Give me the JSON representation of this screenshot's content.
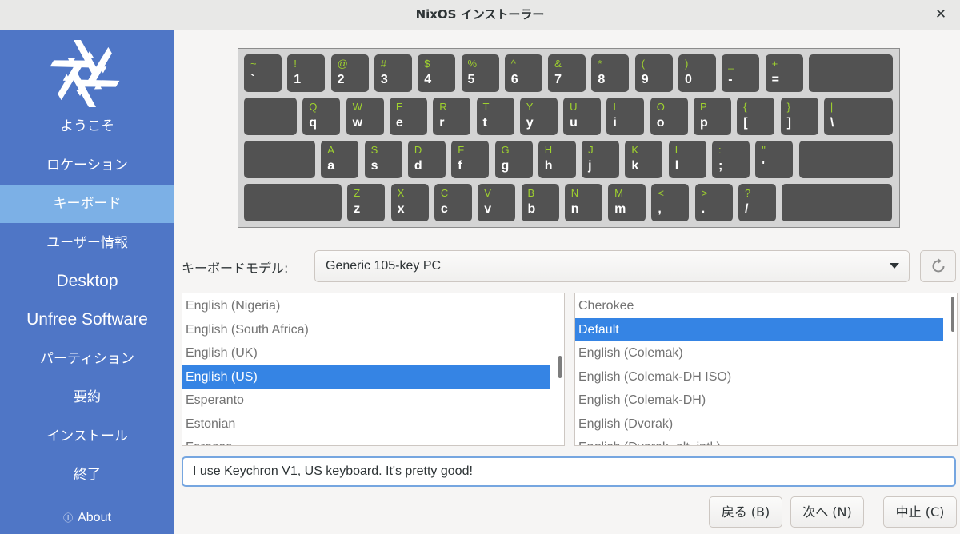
{
  "window": {
    "title": "NixOS インストーラー",
    "close_icon": "close-icon"
  },
  "sidebar": {
    "logo_icon": "nixos-snowflake-icon",
    "items": [
      {
        "label": "ようこそ"
      },
      {
        "label": "ロケーション"
      },
      {
        "label": "キーボード",
        "active": true
      },
      {
        "label": "ユーザー情報"
      },
      {
        "label": "Desktop"
      },
      {
        "label": "Unfree Software"
      },
      {
        "label": "パーティション"
      },
      {
        "label": "要約"
      },
      {
        "label": "インストール"
      },
      {
        "label": "終了"
      }
    ],
    "about_label": "About",
    "about_icon": "info-icon"
  },
  "keyboard_rows": [
    [
      {
        "u": "~",
        "l": "`"
      },
      {
        "u": "!",
        "l": "1"
      },
      {
        "u": "@",
        "l": "2"
      },
      {
        "u": "#",
        "l": "3"
      },
      {
        "u": "$",
        "l": "4"
      },
      {
        "u": "%",
        "l": "5"
      },
      {
        "u": "^",
        "l": "6"
      },
      {
        "u": "&",
        "l": "7"
      },
      {
        "u": "*",
        "l": "8"
      },
      {
        "u": "(",
        "l": "9"
      },
      {
        "u": ")",
        "l": "0"
      },
      {
        "u": "_",
        "l": "-"
      },
      {
        "u": "+",
        "l": "="
      },
      {
        "u": "",
        "l": ""
      }
    ],
    [
      {
        "u": "",
        "l": ""
      },
      {
        "u": "Q",
        "l": "q"
      },
      {
        "u": "W",
        "l": "w"
      },
      {
        "u": "E",
        "l": "e"
      },
      {
        "u": "R",
        "l": "r"
      },
      {
        "u": "T",
        "l": "t"
      },
      {
        "u": "Y",
        "l": "y"
      },
      {
        "u": "U",
        "l": "u"
      },
      {
        "u": "I",
        "l": "i"
      },
      {
        "u": "O",
        "l": "o"
      },
      {
        "u": "P",
        "l": "p"
      },
      {
        "u": "{",
        "l": "["
      },
      {
        "u": "}",
        "l": "]"
      },
      {
        "u": "|",
        "l": "\\"
      }
    ],
    [
      {
        "u": "",
        "l": ""
      },
      {
        "u": "A",
        "l": "a"
      },
      {
        "u": "S",
        "l": "s"
      },
      {
        "u": "D",
        "l": "d"
      },
      {
        "u": "F",
        "l": "f"
      },
      {
        "u": "G",
        "l": "g"
      },
      {
        "u": "H",
        "l": "h"
      },
      {
        "u": "J",
        "l": "j"
      },
      {
        "u": "K",
        "l": "k"
      },
      {
        "u": "L",
        "l": "l"
      },
      {
        "u": ":",
        "l": ";"
      },
      {
        "u": "\"",
        "l": "'"
      },
      {
        "u": "",
        "l": ""
      }
    ],
    [
      {
        "u": "",
        "l": ""
      },
      {
        "u": "Z",
        "l": "z"
      },
      {
        "u": "X",
        "l": "x"
      },
      {
        "u": "C",
        "l": "c"
      },
      {
        "u": "V",
        "l": "v"
      },
      {
        "u": "B",
        "l": "b"
      },
      {
        "u": "N",
        "l": "n"
      },
      {
        "u": "M",
        "l": "m"
      },
      {
        "u": "<",
        "l": ","
      },
      {
        "u": ">",
        "l": "."
      },
      {
        "u": "?",
        "l": "/"
      },
      {
        "u": "",
        "l": ""
      }
    ]
  ],
  "model": {
    "label": "キーボードモデル:",
    "value": "Generic 105-key PC",
    "reset_icon": "reset-icon",
    "dropdown_icon": "dropdown-arrow-icon"
  },
  "layouts": {
    "items": [
      "English (Nigeria)",
      "English (South Africa)",
      "English (UK)",
      "English (US)",
      "Esperanto",
      "Estonian",
      "Faroese"
    ],
    "selected": "English (US)"
  },
  "variants": {
    "items": [
      "Cherokee",
      "Default",
      "English (Colemak)",
      "English (Colemak-DH ISO)",
      "English (Colemak-DH)",
      "English (Dvorak)",
      "English (Dvorak, alt. intl.)"
    ],
    "selected": "Default"
  },
  "test_input": {
    "value": "I use Keychron V1, US keyboard. It's pretty good!"
  },
  "buttons": {
    "back": "戻る (B)",
    "next": "次へ (N)",
    "cancel": "中止 (C)"
  }
}
